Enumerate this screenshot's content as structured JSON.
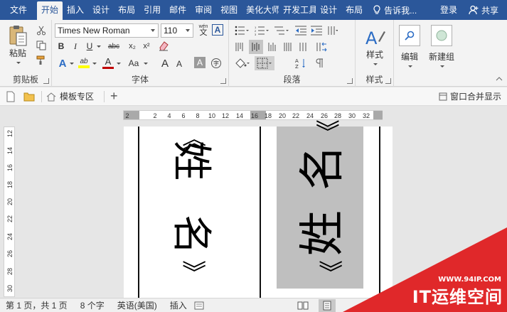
{
  "menu": {
    "tabs": [
      "文件",
      "开始",
      "插入",
      "设计",
      "布局",
      "引用",
      "邮件",
      "审阅",
      "视图",
      "美化大师",
      "开发工具",
      "设计",
      "布局"
    ],
    "active_index": 1,
    "tell_me": "告诉我...",
    "login": "登录",
    "share": "共享"
  },
  "ribbon": {
    "clipboard": {
      "paste": "粘贴",
      "label": "剪贴板"
    },
    "font": {
      "name": "Times New Roman",
      "size": "110",
      "wen_glyph": "wén",
      "bold": "B",
      "italic": "I",
      "underline": "U",
      "strike": "abc",
      "sub": "x₂",
      "sup": "x²",
      "text_effect": "A",
      "highlight": "ab",
      "color": "A",
      "case": "Aa",
      "grow": "A",
      "shrink": "A",
      "char_shade": "A",
      "label": "字体"
    },
    "paragraph": {
      "label": "段落"
    },
    "styles": {
      "button": "样式",
      "label": "样式"
    },
    "editing": {
      "button": "编辑"
    },
    "newgroup": {
      "button": "新建组"
    }
  },
  "toolbar": {
    "template_zone": "模板专区",
    "add": "+",
    "merge_windows": "窗口合并显示"
  },
  "ruler": {
    "ticks": [
      "2",
      "2",
      "4",
      "6",
      "8",
      "10",
      "12",
      "14",
      "16",
      "18",
      "20",
      "22",
      "24",
      "26",
      "28",
      "30",
      "32"
    ],
    "vticks": [
      "12",
      "14",
      "16",
      "18",
      "20",
      "22",
      "24",
      "26",
      "28",
      "30"
    ]
  },
  "document": {
    "left_col": [
      "《",
      "姓",
      "名",
      "》"
    ],
    "right_col": [
      "《",
      "名",
      "姓",
      "》"
    ]
  },
  "status": {
    "page": "第 1 页，共 1 页",
    "words": "8 个字",
    "language": "英语(美国)",
    "mode": "插入"
  },
  "watermark": {
    "url": "WWW.94IP.COM",
    "brand": "IT运维空间"
  },
  "colors": {
    "brand_blue": "#2b579a",
    "watermark_red": "#e0282a",
    "font_color_red": "#c00000",
    "highlight_yellow": "#ffff00"
  }
}
